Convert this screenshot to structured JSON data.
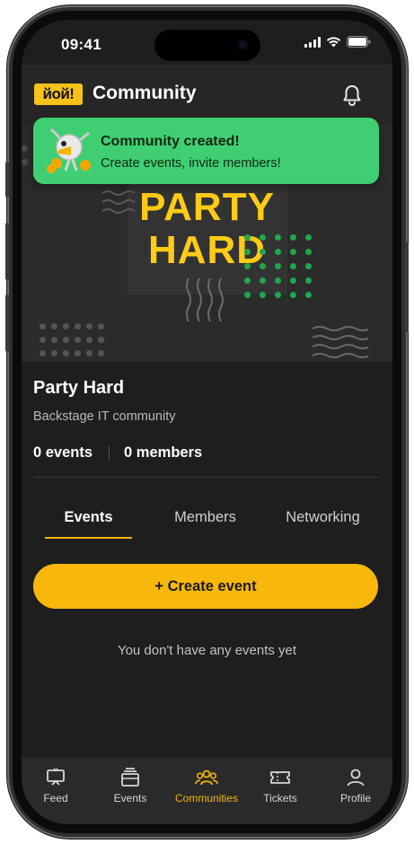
{
  "status_bar": {
    "time": "09:41"
  },
  "header": {
    "logo_text": "йой!",
    "title": "Community",
    "icon": "bell-icon"
  },
  "toast": {
    "title": "Community created!",
    "subtitle": "Create events, invite members!",
    "icon": "mascot-icon"
  },
  "banner": {
    "line1": "PARTY",
    "line2": "HARD",
    "accent_color": "#ffcb16",
    "dot_color": "#1fa84b"
  },
  "community": {
    "name": "Party Hard",
    "description": "Backstage IT community",
    "events_count": "0 events",
    "members_count": "0 members"
  },
  "tabs": [
    {
      "label": "Events",
      "active": true
    },
    {
      "label": "Members",
      "active": false
    },
    {
      "label": "Networking",
      "active": false
    }
  ],
  "create_button": {
    "label": "+ Create event",
    "color": "#fab70b"
  },
  "empty_state": {
    "text": "You don't have any events yet"
  },
  "bottom_nav": [
    {
      "label": "Feed",
      "icon": "feed-icon",
      "active": false
    },
    {
      "label": "Events",
      "icon": "events-icon",
      "active": false
    },
    {
      "label": "Communities",
      "icon": "communities-icon",
      "active": true
    },
    {
      "label": "Tickets",
      "icon": "ticket-icon",
      "active": false
    },
    {
      "label": "Profile",
      "icon": "profile-icon",
      "active": false
    }
  ]
}
